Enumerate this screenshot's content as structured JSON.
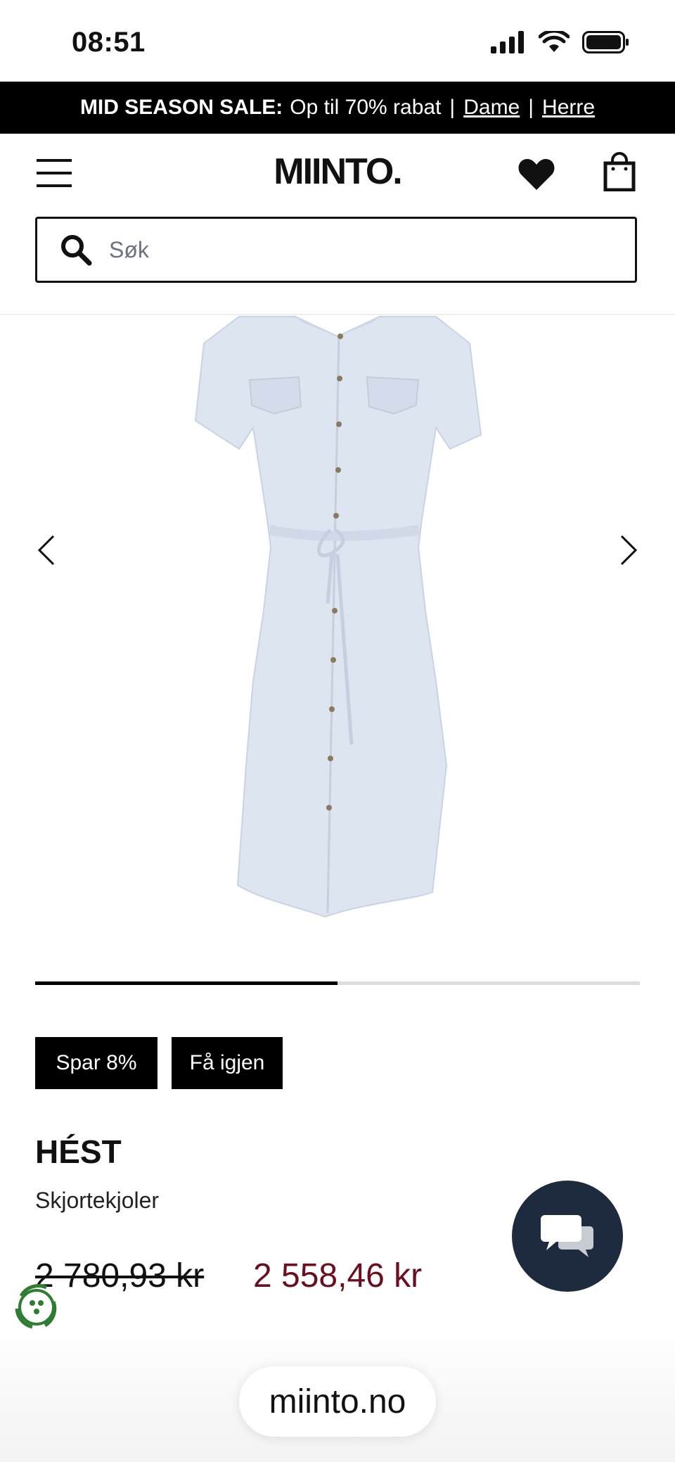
{
  "status_bar": {
    "time": "08:51"
  },
  "promo": {
    "bold_text": "MID SEASON SALE:",
    "text": "Op til 70% rabat",
    "separator": "|",
    "link_women": "Dame",
    "link_men": "Herre"
  },
  "header": {
    "logo": "MIINTO."
  },
  "search": {
    "placeholder": "Søk"
  },
  "gallery": {
    "progress": 0.5
  },
  "badges": {
    "save": "Spar 8%",
    "back_in_stock": "Få igjen"
  },
  "product": {
    "brand": "HÉST",
    "category": "Skjortekjoler",
    "old_price": "2 780,93 kr",
    "new_price": "2 558,46 kr"
  },
  "browser": {
    "url": "miinto.no"
  },
  "colors": {
    "sale_price": "#6b0f1f",
    "chat_bg": "#1e2a3d",
    "dress": "#dde5f1"
  }
}
